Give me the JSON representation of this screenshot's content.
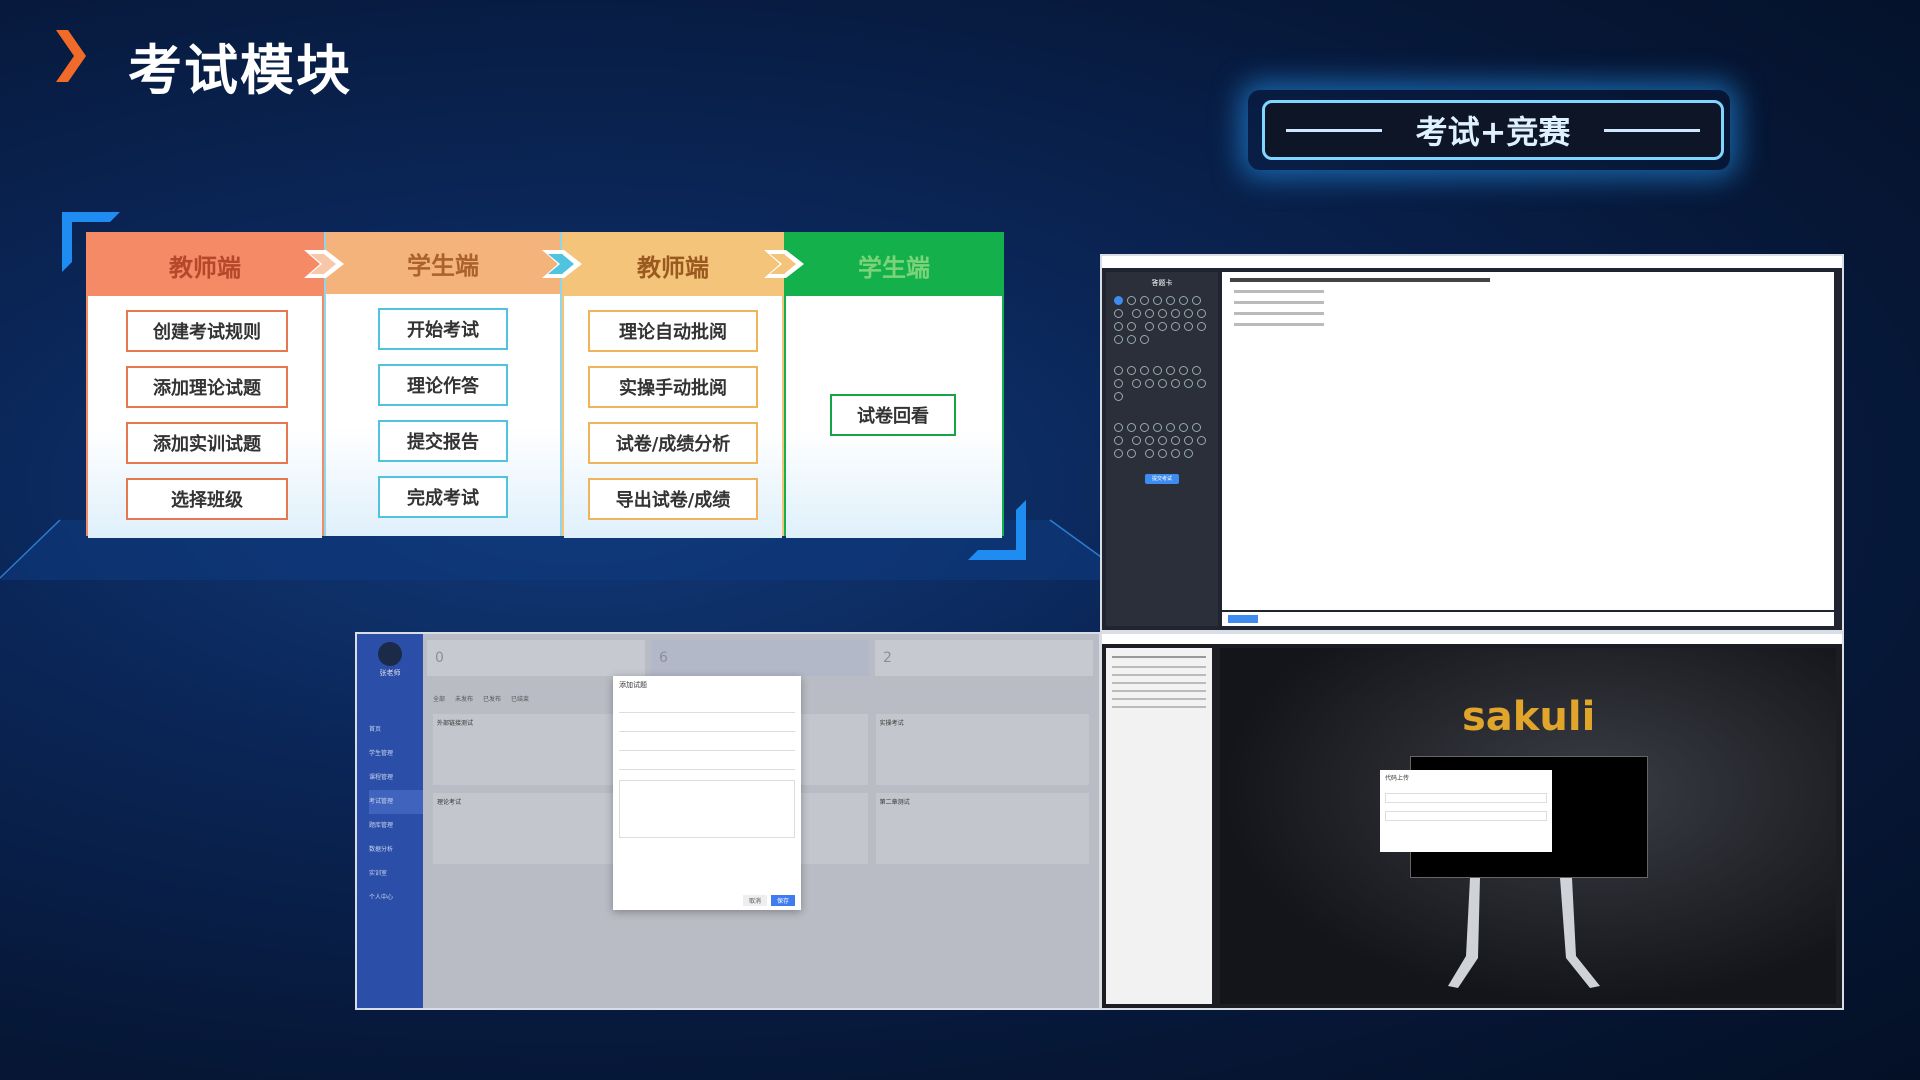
{
  "page": {
    "title": "考试模块"
  },
  "badge": {
    "text": "考试+竞赛"
  },
  "colors": {
    "accent_orange": "#f06a2a",
    "teacher_head": "#f58a66",
    "student_head": "#f4b37b",
    "teacher2_head": "#f3c47a",
    "student2_head": "#14b04b",
    "badge_border": "#7fd6ff"
  },
  "workflow": {
    "columns": [
      {
        "header": "教师端",
        "steps": [
          "创建考试规则",
          "添加理论试题",
          "添加实训试题",
          "选择班级"
        ]
      },
      {
        "header": "学生端",
        "steps": [
          "开始考试",
          "理论作答",
          "提交报告",
          "完成考试"
        ]
      },
      {
        "header": "教师端",
        "steps": [
          "理论自动批阅",
          "实操手动批阅",
          "试卷/成绩分析",
          "导出试卷/成绩"
        ]
      },
      {
        "header": "学生端",
        "steps": [
          "试卷回看"
        ]
      }
    ]
  },
  "screenshots": {
    "exam": {
      "nav_title": "答题卡",
      "submit_label": "提交考试",
      "icon": "exam-interface"
    },
    "admin": {
      "user_name": "张老师",
      "stat_values": [
        "0",
        "6",
        "2"
      ],
      "filter_tabs": [
        "全部",
        "未发布",
        "已发布",
        "已结束"
      ],
      "dialog_title": "添加试题",
      "dialog_cancel": "取消",
      "dialog_confirm": "保存",
      "sidebar_items": [
        "首页",
        "学生管理",
        "课程管理",
        "考试管理",
        "题库管理",
        "数据分析",
        "实训室",
        "个人中心"
      ],
      "cards": [
        "外部链接测试",
        "测试",
        "实操考试",
        "理论考试",
        "实操",
        "第二章测试"
      ]
    },
    "lab": {
      "logo_text": "sakuli",
      "dialog_title": "代码上传",
      "icon": "sakuli-logo"
    }
  }
}
